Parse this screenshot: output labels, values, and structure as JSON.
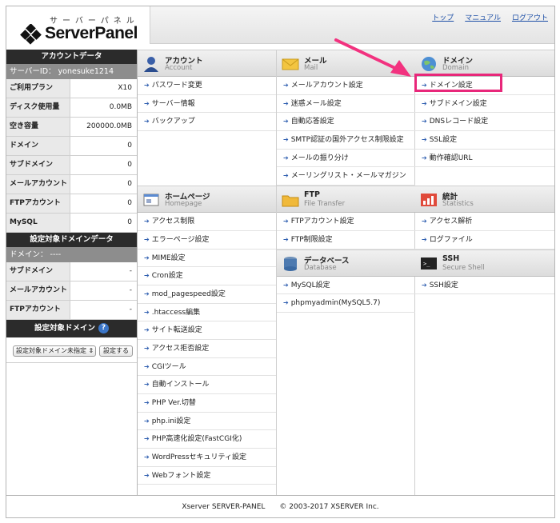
{
  "header": {
    "logo_kana": "サーバーパネル",
    "logo_text": "ServerPanel",
    "links": [
      "トップ",
      "マニュアル",
      "ログアウト"
    ]
  },
  "sidebar": {
    "account_title": "アカウントデータ",
    "server_id": "サーバーID： yonesuke1214",
    "rows": [
      {
        "k": "ご利用プラン",
        "v": "X10"
      },
      {
        "k": "ディスク使用量",
        "v": "0.0MB"
      },
      {
        "k": "空き容量",
        "v": "200000.0MB"
      },
      {
        "k": "ドメイン",
        "v": "0"
      },
      {
        "k": "サブドメイン",
        "v": "0"
      },
      {
        "k": "メールアカウント",
        "v": "0"
      },
      {
        "k": "FTPアカウント",
        "v": "0"
      },
      {
        "k": "MySQL",
        "v": "0"
      }
    ],
    "domain_data_title": "設定対象ドメインデータ",
    "domain_label": "ドメイン： ----",
    "domain_rows": [
      {
        "k": "サブドメイン",
        "v": "-"
      },
      {
        "k": "メールアカウント",
        "v": "-"
      },
      {
        "k": "FTPアカウント",
        "v": "-"
      }
    ],
    "target_domain_title": "設定対象ドメイン",
    "help": "?",
    "select_value": "設定対象ドメイン未指定",
    "submit_label": "設定する"
  },
  "columns": {
    "account": {
      "t1": "アカウント",
      "t2": "Account",
      "items": [
        "パスワード変更",
        "サーバー情報",
        "バックアップ"
      ]
    },
    "mail": {
      "t1": "メール",
      "t2": "Mail",
      "items": [
        "メールアカウント設定",
        "迷惑メール設定",
        "自動応答設定",
        "SMTP認証の国外アクセス制限設定",
        "メールの振り分け",
        "メーリングリスト・メールマガジン"
      ]
    },
    "domain": {
      "t1": "ドメイン",
      "t2": "Domain",
      "items": [
        "ドメイン設定",
        "サブドメイン設定",
        "DNSレコード設定",
        "SSL設定",
        "動作確認URL"
      ]
    },
    "homepage": {
      "t1": "ホームページ",
      "t2": "Homepage",
      "items": [
        "アクセス制限",
        "エラーページ設定",
        "MIME設定",
        "Cron設定",
        "mod_pagespeed設定",
        ".htaccess編集",
        "サイト転送設定",
        "アクセス拒否設定",
        "CGIツール",
        "自動インストール",
        "PHP Ver.切替",
        "php.ini設定",
        "PHP高速化設定(FastCGI化)",
        "WordPressセキュリティ設定",
        "Webフォント設定"
      ]
    },
    "ftp": {
      "t1": "FTP",
      "t2": "File Transfer",
      "items": [
        "FTPアカウント設定",
        "FTP制限設定"
      ]
    },
    "stats": {
      "t1": "統計",
      "t2": "Statistics",
      "items": [
        "アクセス解析",
        "ログファイル"
      ]
    },
    "database": {
      "t1": "データベース",
      "t2": "Database",
      "items": [
        "MySQL設定",
        "phpmyadmin(MySQL5.7)"
      ]
    },
    "ssh": {
      "t1": "SSH",
      "t2": "Secure Shell",
      "items": [
        "SSH設定"
      ]
    }
  },
  "footer": "Xserver SERVER-PANEL　　© 2003-2017 XSERVER Inc.",
  "colors": {
    "highlight": "#e8277a",
    "link": "#1d4fa6"
  }
}
